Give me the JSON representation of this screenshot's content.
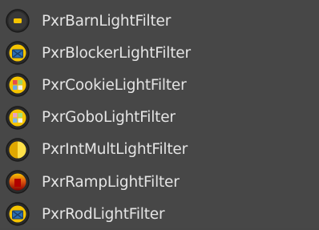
{
  "menu": {
    "items": [
      {
        "label": "PxrBarnLightFilter",
        "icon": "barn-light-filter-icon"
      },
      {
        "label": "PxrBlockerLightFilter",
        "icon": "blocker-light-filter-icon"
      },
      {
        "label": "PxrCookieLightFilter",
        "icon": "cookie-light-filter-icon"
      },
      {
        "label": "PxrGoboLightFilter",
        "icon": "gobo-light-filter-icon"
      },
      {
        "label": "PxrIntMultLightFilter",
        "icon": "intmult-light-filter-icon"
      },
      {
        "label": "PxrRampLightFilter",
        "icon": "ramp-light-filter-icon"
      },
      {
        "label": "PxrRodLightFilter",
        "icon": "rod-light-filter-icon"
      }
    ]
  },
  "colors": {
    "background": "#474747",
    "text": "#e4e4e4",
    "icon_ring": "#222222",
    "yellow": "#f5c400",
    "blue": "#2b6fb3",
    "red": "#c01010"
  }
}
